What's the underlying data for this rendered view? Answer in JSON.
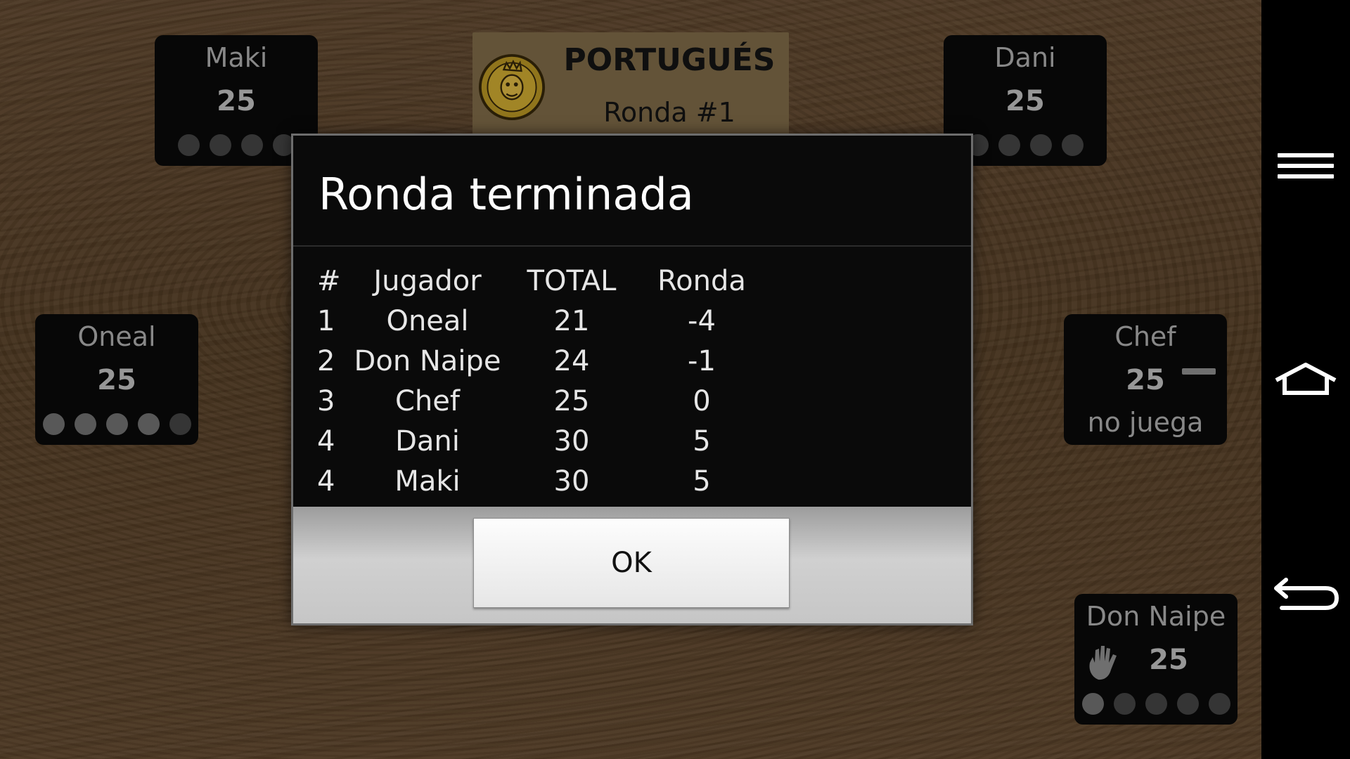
{
  "game": {
    "title": "PORTUGUÉS",
    "round": "Ronda #1",
    "logo_icon": "don-naipe-logo-icon"
  },
  "players": {
    "maki": {
      "name": "Maki",
      "score": "25",
      "dots_total": 4,
      "dots_active": 0
    },
    "dani": {
      "name": "Dani",
      "score": "25",
      "dots_total": 4,
      "dots_active": 0
    },
    "oneal": {
      "name": "Oneal",
      "score": "25",
      "dots_total": 5,
      "dots_active": 4
    },
    "chef": {
      "name": "Chef",
      "score": "25",
      "status": "no juega"
    },
    "don_naipe": {
      "name": "Don Naipe",
      "score": "25",
      "dots_total": 5,
      "dots_active": 1,
      "icon": "hand-icon"
    }
  },
  "dialog": {
    "title": "Ronda terminada",
    "headers": {
      "rank": "#",
      "player": "Jugador",
      "total": "TOTAL",
      "round": "Ronda"
    },
    "rows": [
      {
        "rank": "1",
        "player": "Oneal",
        "total": "21",
        "round": "-4"
      },
      {
        "rank": "2",
        "player": "Don Naipe",
        "total": "24",
        "round": "-1"
      },
      {
        "rank": "3",
        "player": "Chef",
        "total": "25",
        "round": "0"
      },
      {
        "rank": "4",
        "player": "Dani",
        "total": "30",
        "round": "5"
      },
      {
        "rank": "4",
        "player": "Maki",
        "total": "30",
        "round": "5"
      }
    ],
    "ok_label": "OK"
  },
  "navbar": {
    "icons": [
      "menu-icon",
      "home-icon",
      "back-icon"
    ]
  },
  "colors": {
    "wood": "#6b4f33",
    "panel": "#0b0b0b",
    "title_box": "#8a744e"
  }
}
